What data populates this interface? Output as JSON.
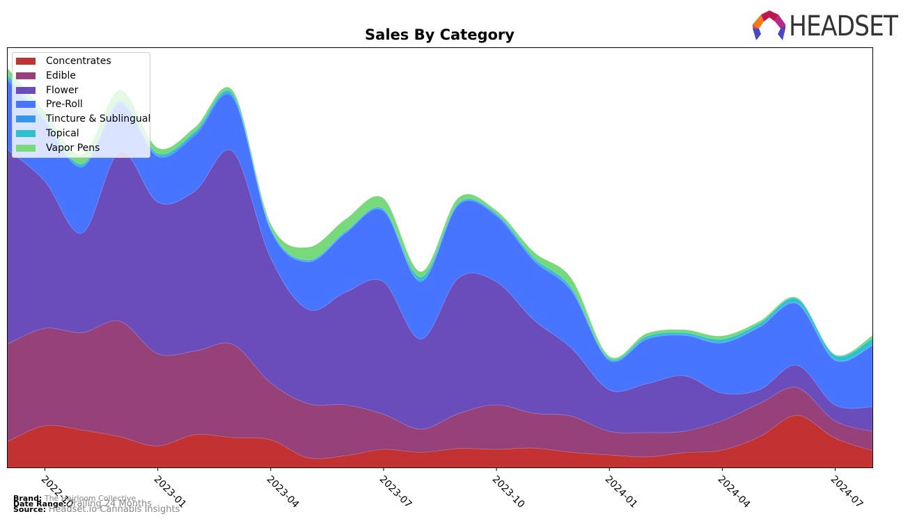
{
  "header": {
    "logo_text": "HEADSET"
  },
  "footer": {
    "brand_label": "Brand:",
    "brand_value": "The Heirloom Collective",
    "date_label": "Date Range:",
    "date_value": "Trailing 24 Months",
    "source_label": "Source:",
    "source_value": "Headset.io Cannabis Insights"
  },
  "chart_data": {
    "type": "area",
    "stacked": true,
    "smoothed": true,
    "title": "Sales By Category",
    "xlabel": "",
    "ylabel": "",
    "y_axis_visible": false,
    "ylim": [
      0,
      100
    ],
    "grid": false,
    "legend_position": "top-left",
    "x": [
      "2022-09",
      "2022-10",
      "2022-11",
      "2022-12",
      "2023-01",
      "2023-02",
      "2023-03",
      "2023-04",
      "2023-05",
      "2023-06",
      "2023-07",
      "2023-08",
      "2023-09",
      "2023-10",
      "2023-11",
      "2023-12",
      "2024-01",
      "2024-02",
      "2024-03",
      "2024-04",
      "2024-05",
      "2024-06",
      "2024-07",
      "2024-08"
    ],
    "x_tick_labels": [
      "2022-10",
      "2023-01",
      "2023-04",
      "2023-07",
      "2023-10",
      "2024-01",
      "2024-04",
      "2024-07"
    ],
    "series": [
      {
        "name": "Concentrates",
        "color": "#c23232",
        "values": [
          6.1,
          9.9,
          8.9,
          7.3,
          5.1,
          7.8,
          7.1,
          6.6,
          2.3,
          2.8,
          4.3,
          3.6,
          4.5,
          4.3,
          4.6,
          3.6,
          3.0,
          2.5,
          3.5,
          4.1,
          7.3,
          12.4,
          7.0,
          4.0
        ]
      },
      {
        "name": "Edible",
        "color": "#96417a",
        "values": [
          23.2,
          23.2,
          23.2,
          27.5,
          22.0,
          19.9,
          22.2,
          13.6,
          12.9,
          12.1,
          8.4,
          5.5,
          8.3,
          10.6,
          8.3,
          8.6,
          5.6,
          5.8,
          5.1,
          7.0,
          7.9,
          6.6,
          4.1,
          4.6
        ]
      },
      {
        "name": "Flower",
        "color": "#6a4dbb",
        "values": [
          46.4,
          35.1,
          23.7,
          40.4,
          36.1,
          38.1,
          45.9,
          29.8,
          22.4,
          26.8,
          31.5,
          21.4,
          32.3,
          29.3,
          22.2,
          16.2,
          9.9,
          11.6,
          13.2,
          6.6,
          3.3,
          5.3,
          3.8,
          5.8
        ]
      },
      {
        "name": "Pre-Roll",
        "color": "#4775ff",
        "values": [
          16.6,
          14.1,
          15.7,
          11.3,
          10.8,
          13.2,
          12.9,
          6.6,
          11.3,
          14.1,
          16.9,
          13.7,
          17.4,
          15.7,
          14.1,
          13.6,
          7.0,
          10.6,
          9.6,
          11.9,
          14.9,
          14.6,
          10.6,
          14.6
        ]
      },
      {
        "name": "Tincture & Sublingual",
        "color": "#3697e8",
        "values": [
          0.5,
          0.5,
          0.3,
          0.3,
          0.3,
          0.5,
          0.3,
          0.3,
          0.2,
          0.2,
          0.2,
          0.3,
          0.2,
          0.3,
          0.3,
          0.3,
          0.2,
          0.2,
          0.2,
          0.2,
          0.2,
          0.2,
          0.2,
          0.2
        ]
      },
      {
        "name": "Topical",
        "color": "#2ebfd1",
        "values": [
          0.7,
          0.3,
          0.5,
          0.5,
          0.5,
          0.5,
          0.5,
          0.3,
          0.3,
          0.3,
          0.3,
          0.8,
          0.3,
          0.3,
          0.5,
          0.5,
          0.3,
          0.5,
          0.5,
          0.7,
          0.7,
          1.0,
          1.0,
          1.5
        ]
      },
      {
        "name": "Vapor Pens",
        "color": "#77d97a",
        "values": [
          1.7,
          1.7,
          2.2,
          2.5,
          1.3,
          1.0,
          0.8,
          1.0,
          3.0,
          2.8,
          2.5,
          1.3,
          1.2,
          0.7,
          1.3,
          2.2,
          0.5,
          0.7,
          0.7,
          0.8,
          0.5,
          0.3,
          0.2,
          0.7
        ]
      }
    ]
  }
}
